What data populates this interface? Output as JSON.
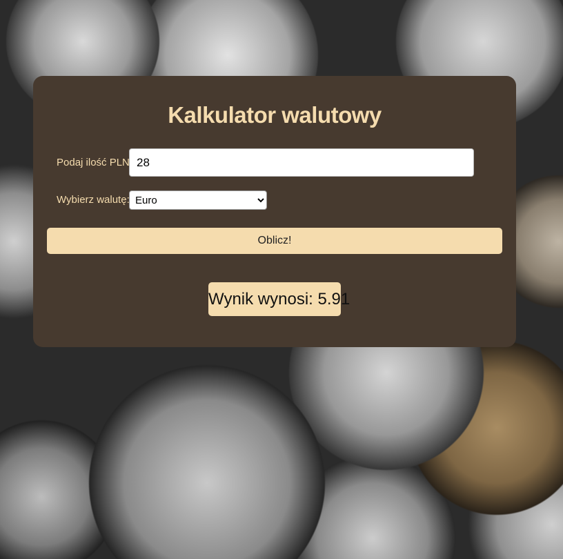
{
  "calculator": {
    "title": "Kalkulator walutowy",
    "amount_label": "Podaj ilość PLN:",
    "amount_value": "28",
    "currency_label": "Wybierz walutę:",
    "currency_selected": "Euro",
    "button_label": "Oblicz!",
    "result_text": "Wynik wynosi: 5.91"
  },
  "colors": {
    "card_background": "#473a2f",
    "accent": "#f5dcae"
  }
}
